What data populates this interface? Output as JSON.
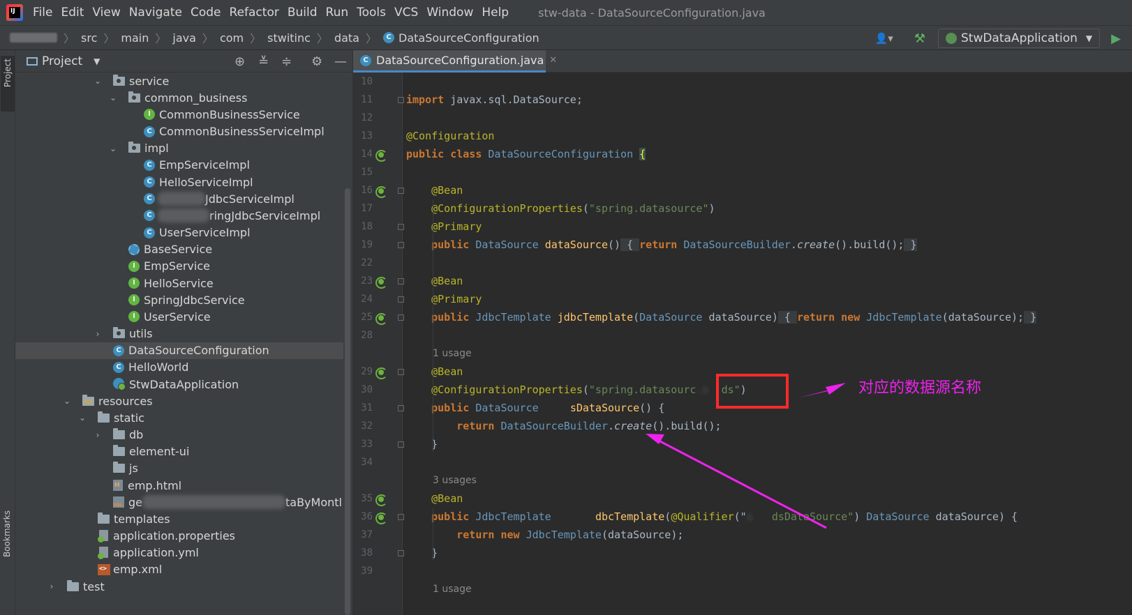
{
  "menubar": {
    "items": [
      "File",
      "Edit",
      "View",
      "Navigate",
      "Code",
      "Refactor",
      "Build",
      "Run",
      "Tools",
      "VCS",
      "Window",
      "Help"
    ],
    "window_title": "stw-data - DataSourceConfiguration.java"
  },
  "navbar": {
    "breadcrumbs": [
      "src",
      "main",
      "java",
      "com",
      "stwitinc",
      "data",
      "DataSourceConfiguration"
    ],
    "run_config": "StwDataApplication"
  },
  "stripe": {
    "project": "Project",
    "bookmarks": "Bookmarks"
  },
  "project_panel": {
    "title": "Project",
    "tree": [
      "service",
      "common_business",
      "CommonBusinessService",
      "CommonBusinessServiceImpl",
      "impl",
      "EmpServiceImpl",
      "HelloServiceImpl",
      "JdbcServiceImpl",
      "ringJdbcServiceImpl",
      "UserServiceImpl",
      "BaseService",
      "EmpService",
      "HelloService",
      "SpringJdbcService",
      "UserService",
      "utils",
      "DataSourceConfiguration",
      "HelloWorld",
      "StwDataApplication",
      "resources",
      "static",
      "db",
      "element-ui",
      "js",
      "emp.html",
      "ge",
      "taByMontl",
      "templates",
      "application.properties",
      "application.yml",
      "emp.xml",
      "test"
    ]
  },
  "editor": {
    "tab_label": "DataSourceConfiguration.java",
    "line_numbers": [
      "10",
      "11",
      "12",
      "13",
      "14",
      "15",
      "16",
      "17",
      "18",
      "19",
      "22",
      "23",
      "24",
      "25",
      "28",
      "29",
      "30",
      "31",
      "32",
      "33",
      "34",
      "35",
      "36",
      "37",
      "38",
      "39"
    ],
    "code": {
      "l11_kw": "import",
      "l11_rest": " javax.sql.DataSource;",
      "l13": "@Configuration",
      "l14_kw": "public class",
      "l14_name": " DataSourceConfiguration ",
      "l14_brace": "{",
      "bean": "@Bean",
      "cfgprops": "@ConfigurationProperties",
      "str_ds": "\"spring.datasource\"",
      "primary": "@Primary",
      "public": "public",
      "datasource_type": "DataSource",
      "l19_fn": "dataSource",
      "return": "return",
      "builder": "DataSourceBuilder",
      "create": "create",
      "build": "build",
      "jdbc_type": "JdbcTemplate",
      "l25_fn": "jdbcTemplate",
      "param": "dataSource",
      "new": "new",
      "hint_1": "1 usage",
      "str_ds2_a": "\"spring.datasourc",
      "str_ds2_b": "ds\"",
      "l31_fn": "sDataSource",
      "hint_3": "3 usages",
      "l36_fn": "dbcTemplate",
      "qualifier": "@Qualifier",
      "str_q": "dsDataSource\"",
      "hint_1b": "1 usage"
    }
  },
  "annotation": {
    "label": "对应的数据源名称"
  },
  "colors": {
    "keyword": "#cc7832",
    "annotation": "#bbb529",
    "string": "#6a8759",
    "type": "#6897bb",
    "markup": "#ff2a2a",
    "arrow": "#ee22ee"
  }
}
